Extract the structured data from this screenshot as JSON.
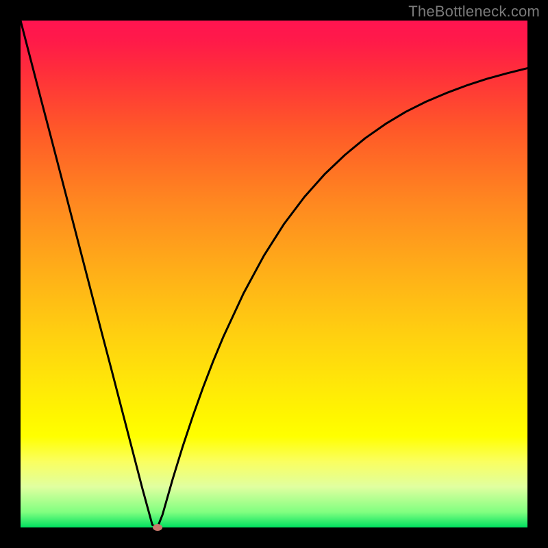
{
  "attribution": "TheBottleneck.com",
  "colors": {
    "frame": "#000000",
    "curve": "#000000",
    "marker": "#c9786d",
    "gradient_top": "#ff1450",
    "gradient_bottom": "#00e060"
  },
  "chart_data": {
    "type": "line",
    "title": "",
    "xlabel": "",
    "ylabel": "",
    "xlim": [
      0,
      100
    ],
    "ylim": [
      0,
      100
    ],
    "series": [
      {
        "name": "bottleneck-curve",
        "x": [
          0,
          2,
          4,
          6,
          8,
          10,
          12,
          14,
          16,
          18,
          20,
          22,
          24,
          26,
          27,
          28,
          30,
          32,
          34,
          36,
          38,
          40,
          44,
          48,
          52,
          56,
          60,
          64,
          68,
          72,
          76,
          80,
          84,
          88,
          92,
          96,
          100
        ],
        "y": [
          100,
          92.3,
          84.6,
          77.0,
          69.3,
          61.6,
          53.9,
          46.2,
          38.5,
          30.9,
          23.2,
          15.5,
          7.8,
          0.5,
          0,
          2.5,
          9.5,
          16.0,
          22.0,
          27.6,
          32.8,
          37.6,
          46.2,
          53.6,
          59.9,
          65.2,
          69.7,
          73.5,
          76.8,
          79.6,
          82.0,
          84.0,
          85.7,
          87.2,
          88.5,
          89.6,
          90.6
        ]
      }
    ],
    "marker": {
      "x": 27,
      "y": 0
    },
    "annotations": []
  }
}
